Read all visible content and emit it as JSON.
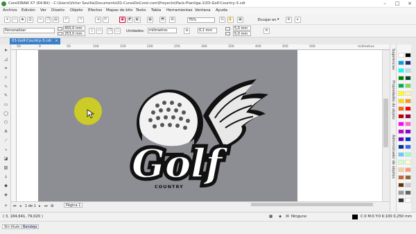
{
  "window": {
    "title": "CorelDRAW X7 (64-Bit) - C:\\Users\\Victor Sevilla\\Documents\\01-CursoDeCorel.com\\Proyecto\\Pack-Plantiga-1\\03-Golf-Country-3.cdr"
  },
  "menu": [
    "Archivo",
    "Edición",
    "Ver",
    "Diseño",
    "Objeto",
    "Efectos",
    "Mapas de bits",
    "Texto",
    "Tabla",
    "Herramientas",
    "Ventana",
    "Ayuda"
  ],
  "standard_toolbar": {
    "zoom_value": "75%",
    "snap_label": "Encajar en",
    "icons": [
      "new-icon",
      "open-icon",
      "save-icon",
      "print-icon",
      "cut-icon",
      "copy-icon",
      "paste-icon",
      "undo-icon",
      "redo-icon",
      "import-icon",
      "export-icon",
      "publish-pdf-icon",
      "app-launcher-icon",
      "zoom-level",
      "fit-page-icon",
      "options-icon"
    ]
  },
  "property_bar": {
    "page_preset": "Personalizar",
    "width": "450,0 mm",
    "height": "253,0 mm",
    "units_label": "Unidades:",
    "units": "milímetros",
    "nudge": "0,1 mm",
    "dup_x": "5,0 mm",
    "dup_y": "5,0 mm"
  },
  "document_tab": {
    "label": "03-Golf-Country-3.cdr"
  },
  "ruler": {
    "top_ticks": [
      "50",
      "0",
      "50",
      "100",
      "150",
      "200",
      "250",
      "300",
      "350",
      "400",
      "450",
      "500",
      "milímetros"
    ]
  },
  "artwork": {
    "main_text": "Golf",
    "sub_text": "COUNTRY"
  },
  "page_nav": {
    "page_count": "1 de 1",
    "page_tab": "Página 1"
  },
  "palette_colors": [
    [
      "#ffffff",
      "#000000"
    ],
    [
      "#00a0e3",
      "#1f2a7a"
    ],
    [
      "#00ffff",
      "#b0e0f0"
    ],
    [
      "#008000",
      "#004d26"
    ],
    [
      "#00b050",
      "#7ed957"
    ],
    [
      "#ffff00",
      "#fff59d"
    ],
    [
      "#ffd700",
      "#ff9900"
    ],
    [
      "#ff6600",
      "#ff0000"
    ],
    [
      "#c00000",
      "#990033"
    ],
    [
      "#ff00ff",
      "#ff66cc"
    ],
    [
      "#cc00cc",
      "#9900cc"
    ],
    [
      "#6600cc",
      "#0033cc"
    ],
    [
      "#003399",
      "#3366ff"
    ],
    [
      "#66ccff",
      "#99ffcc"
    ],
    [
      "#ccffcc",
      "#ffffcc"
    ],
    [
      "#ffcc99",
      "#ff9966"
    ],
    [
      "#cc6633",
      "#996633"
    ],
    [
      "#663300",
      "#cccccc"
    ],
    [
      "#999999",
      "#666666"
    ],
    [
      "#333333",
      "#ffffff"
    ]
  ],
  "dockers": [
    "Sugerencias",
    "Propiedades de objeto",
    "Administrador de objetos"
  ],
  "status": {
    "cursor_pos": "( 3,  184,641, 79,020 )",
    "fill_label": "Ninguno",
    "color_info": "C:0 M:0 Y:0 K:100  0,250 mm"
  },
  "bottom_tabs": [
    "Sin título",
    "Bandeja"
  ]
}
